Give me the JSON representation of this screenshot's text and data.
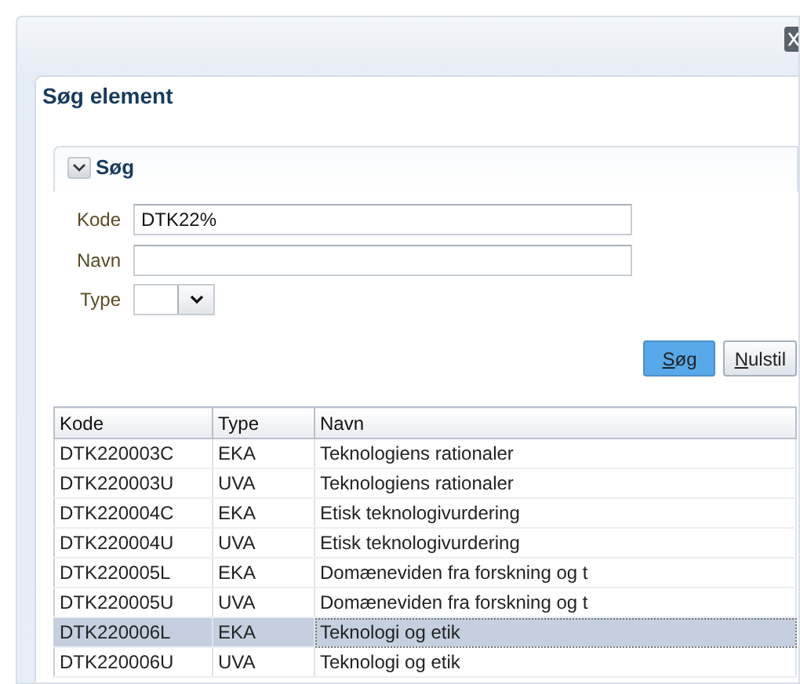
{
  "dialog": {
    "title": "Søg element"
  },
  "search_section": {
    "title": "Søg",
    "expanded": true,
    "fields": [
      {
        "kind": "text",
        "label": "Kode",
        "value": "DTK22%"
      },
      {
        "kind": "text",
        "label": "Navn"
      },
      {
        "kind": "select",
        "label": "Type"
      }
    ],
    "buttons": [
      {
        "label": "Søg",
        "primary": true
      },
      {
        "label": "Nulstil",
        "primary": false
      }
    ]
  },
  "table": {
    "columns": [
      "Kode",
      "Type",
      "Navn"
    ],
    "rows": [
      {
        "cells": [
          "DTK220003C",
          "EKA",
          "Teknologiens rationaler"
        ],
        "selected": false
      },
      {
        "cells": [
          "DTK220003U",
          "UVA",
          "Teknologiens rationaler"
        ],
        "selected": false
      },
      {
        "cells": [
          "DTK220004C",
          "EKA",
          "Etisk teknologivurdering"
        ],
        "selected": false
      },
      {
        "cells": [
          "DTK220004U",
          "UVA",
          "Etisk teknologivurdering"
        ],
        "selected": false
      },
      {
        "cells": [
          "DTK220005L",
          "EKA",
          "Domæneviden fra forskning og t"
        ],
        "selected": false
      },
      {
        "cells": [
          "DTK220005U",
          "UVA",
          "Domæneviden fra forskning og t"
        ],
        "selected": false
      },
      {
        "cells": [
          "DTK220006L",
          "EKA",
          "Teknologi og etik"
        ],
        "selected": true
      },
      {
        "cells": [
          "DTK220006U",
          "UVA",
          "Teknologi og etik"
        ],
        "selected": false
      }
    ]
  }
}
